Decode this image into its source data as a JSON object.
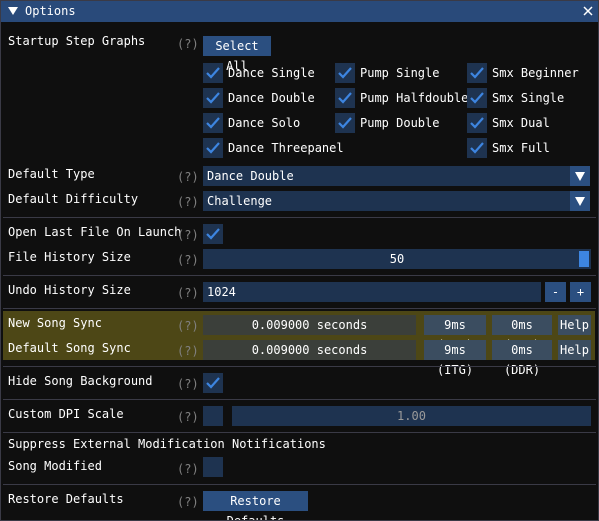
{
  "window": {
    "title": "Options",
    "close_icon": "close-icon"
  },
  "help_marker": "(?)",
  "startup_step_graphs": {
    "label": "Startup Step Graphs",
    "select_all_label": "Select All",
    "items": [
      {
        "label": "Dance Single",
        "checked": true
      },
      {
        "label": "Pump Single",
        "checked": true
      },
      {
        "label": "Smx Beginner",
        "checked": true
      },
      {
        "label": "Dance Double",
        "checked": true
      },
      {
        "label": "Pump Halfdouble",
        "checked": true
      },
      {
        "label": "Smx Single",
        "checked": true
      },
      {
        "label": "Dance Solo",
        "checked": true
      },
      {
        "label": "Pump Double",
        "checked": true
      },
      {
        "label": "Smx Dual",
        "checked": true
      },
      {
        "label": "Dance Threepanel",
        "checked": true
      },
      {
        "label": "Smx Full",
        "checked": true
      }
    ]
  },
  "default_type": {
    "label": "Default Type",
    "value": "Dance Double"
  },
  "default_difficulty": {
    "label": "Default Difficulty",
    "value": "Challenge"
  },
  "open_last_file": {
    "label": "Open Last File On Launch",
    "checked": true
  },
  "file_history_size": {
    "label": "File History Size",
    "value": "50",
    "fraction": 1.0
  },
  "undo_history_size": {
    "label": "Undo History Size",
    "value": "1024",
    "minus": "-",
    "plus": "+"
  },
  "new_song_sync": {
    "label": "New Song Sync",
    "value": "0.009000 seconds",
    "itg": "9ms (ITG)",
    "ddr": "0ms (DDR)",
    "help": "Help"
  },
  "default_song_sync": {
    "label": "Default Song Sync",
    "value": "0.009000 seconds",
    "itg": "9ms (ITG)",
    "ddr": "0ms (DDR)",
    "help": "Help"
  },
  "hide_song_background": {
    "label": "Hide Song Background",
    "checked": true
  },
  "custom_dpi_scale": {
    "label": "Custom DPI Scale",
    "checked": false,
    "value": "1.00"
  },
  "suppress_notifications": {
    "label": "Suppress External Modification Notifications"
  },
  "song_modified": {
    "label": "Song Modified",
    "checked": false
  },
  "restore_defaults": {
    "label": "Restore Defaults",
    "button_label": "Restore Defaults"
  },
  "colors": {
    "accent": "#3d85e0",
    "button": "#2b4f80",
    "frame": "#1e3350",
    "title_bar": "#294a7a",
    "highlight": "#4d4716"
  }
}
